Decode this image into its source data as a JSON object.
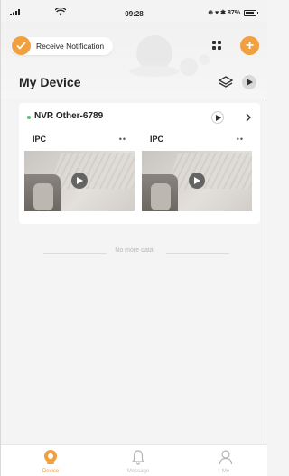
{
  "status_bar": {
    "time": "09:28",
    "battery": "87%",
    "right_icons": "⊕ ♥ ✱"
  },
  "header": {
    "notification_label": "Receive Notification",
    "title": "My Device"
  },
  "device": {
    "name": "NVR Other-6789",
    "status_color": "#5ac07a",
    "channels": [
      {
        "label": "IPC",
        "more": "••"
      },
      {
        "label": "IPC",
        "more": "••"
      }
    ]
  },
  "list_footer": {
    "text": "No more data"
  },
  "tab_bar": {
    "items": [
      {
        "label": "Device",
        "icon": "device-icon",
        "active": true
      },
      {
        "label": "Message",
        "icon": "bell-icon",
        "active": false
      },
      {
        "label": "Me",
        "icon": "user-icon",
        "active": false
      }
    ]
  },
  "colors": {
    "accent": "#f0a040",
    "online": "#5ac07a",
    "background": "#f4f4f4"
  }
}
